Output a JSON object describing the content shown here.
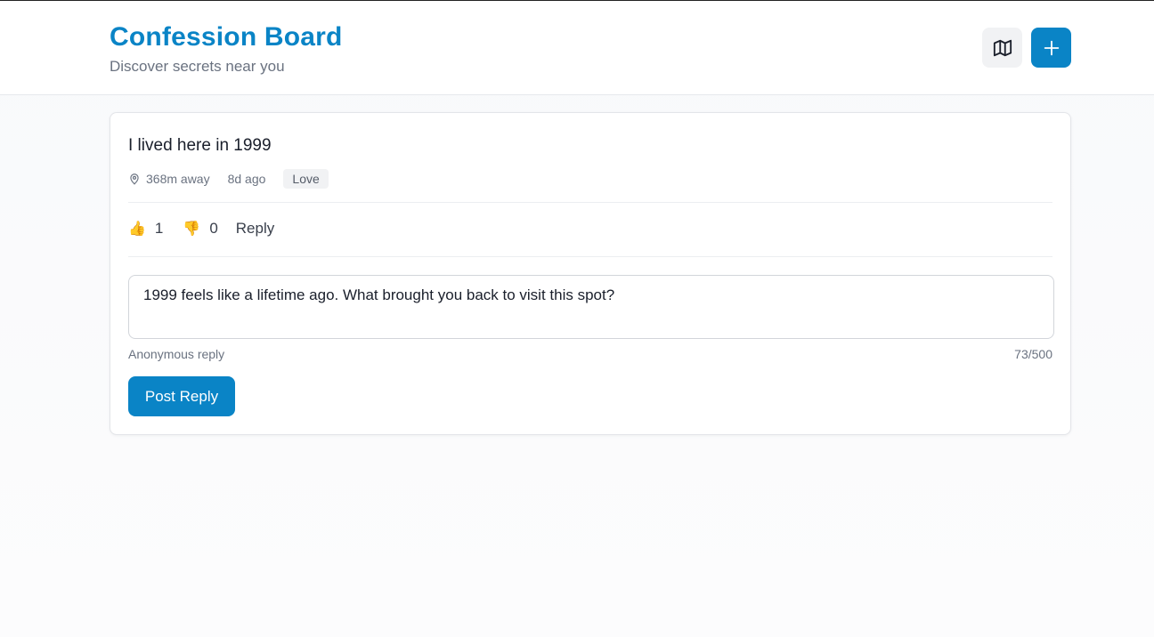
{
  "header": {
    "title": "Confession Board",
    "subtitle": "Discover secrets near you",
    "map_icon": "map-icon",
    "add_icon": "plus-icon",
    "accent_color": "#0a84c6"
  },
  "confession": {
    "text": "I lived here in 1999",
    "distance": "368m away",
    "time_ago": "8d ago",
    "tag": "Love",
    "upvote_emoji": "👍",
    "upvotes": "1",
    "downvote_emoji": "👎",
    "downvotes": "0",
    "reply_label": "Reply"
  },
  "reply_form": {
    "value": "1999 feels like a lifetime ago. What brought you back to visit this spot?",
    "anonymous_label": "Anonymous reply",
    "char_count": "73/500",
    "submit_label": "Post Reply"
  }
}
